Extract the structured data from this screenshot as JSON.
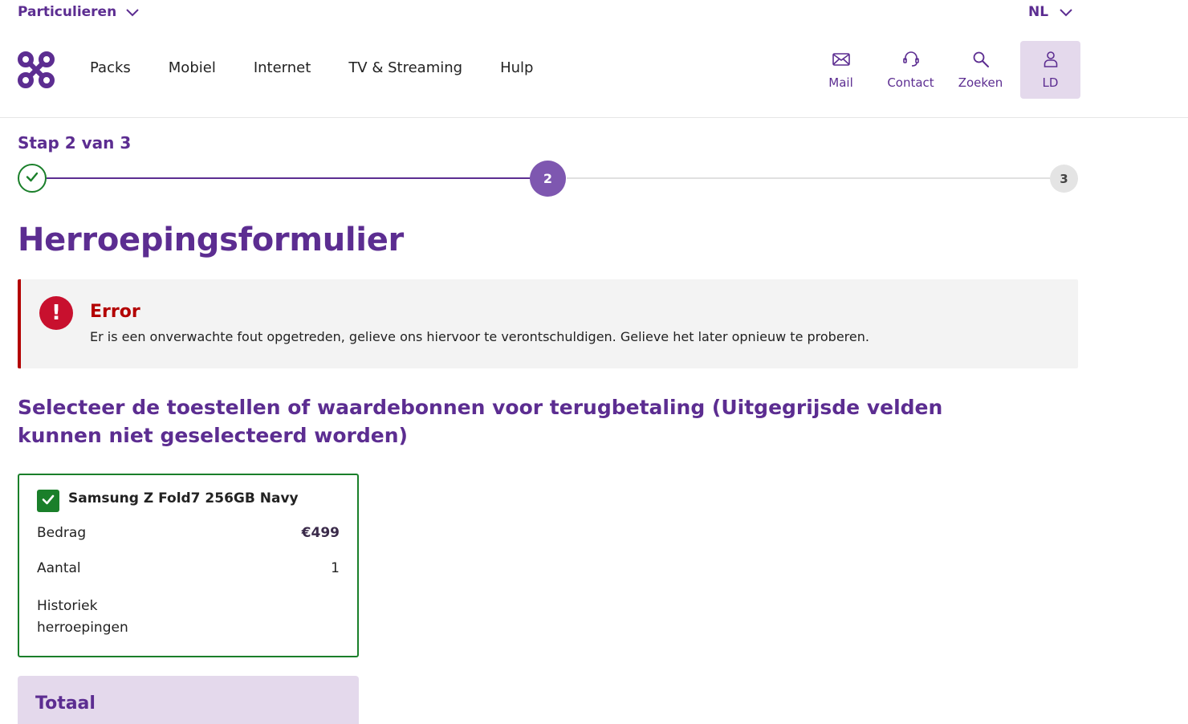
{
  "topbar": {
    "segment_label": "Particulieren",
    "language_label": "NL"
  },
  "nav": {
    "items": [
      "Packs",
      "Mobiel",
      "Internet",
      "TV & Streaming",
      "Hulp"
    ]
  },
  "tools": {
    "mail": "Mail",
    "contact": "Contact",
    "search": "Zoeken",
    "user": "LD"
  },
  "stepper": {
    "label": "Stap 2 van 3",
    "current": "2",
    "next": "3"
  },
  "page": {
    "title": "Herroepingsformulier"
  },
  "error": {
    "title": "Error",
    "message": "Er is een onverwachte fout opgetreden, gelieve ons hiervoor te verontschuldigen. Gelieve het later opnieuw te proberen."
  },
  "section": {
    "heading": "Selecteer de toestellen of waardebonnen voor terugbetaling (Uitgegrijsde velden kunnen niet geselecteerd worden)"
  },
  "device": {
    "name": "Samsung Z Fold7 256GB Navy",
    "selected": true,
    "amount_label": "Bedrag",
    "amount_value": "€499",
    "quantity_label": "Aantal",
    "quantity_value": "1",
    "history_label": "Historiek herroepingen"
  },
  "total": {
    "label": "Totaal"
  },
  "colors": {
    "brand_purple": "#5c2d91",
    "success_green": "#1a7f2a",
    "error_red": "#b30000"
  }
}
